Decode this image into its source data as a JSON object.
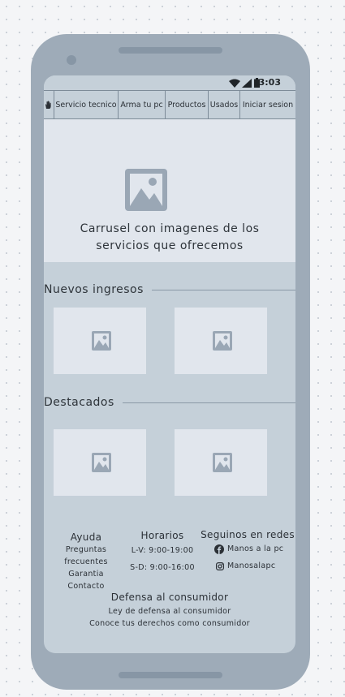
{
  "status_bar": {
    "time": "3:03"
  },
  "nav": {
    "items": [
      "Servicio tecnico",
      "Arma tu pc",
      "Productos",
      "Usados",
      "Iniciar sesion"
    ]
  },
  "hero": {
    "caption_line1": "Carrusel con imagenes de los",
    "caption_line2": "servicios que ofrecemos"
  },
  "sections": {
    "new": {
      "title": "Nuevos ingresos"
    },
    "featured": {
      "title": "Destacados"
    }
  },
  "footer": {
    "help": {
      "title": "Ayuda",
      "links": [
        "Preguntas frecuentes",
        "Garantia",
        "Contacto"
      ]
    },
    "hours": {
      "title": "Horarios",
      "lines": [
        "L-V: 9:00-19:00",
        "S-D: 9:00-16:00"
      ]
    },
    "social": {
      "title": "Seguinos en redes",
      "facebook": "Manos a la pc",
      "instagram": "Manosalapc"
    },
    "consumer": {
      "title": "Defensa al consumidor",
      "links": [
        "Ley de defensa al consumidor",
        "Conoce tus derechos como consumidor"
      ]
    }
  },
  "colors": {
    "screen_bg": "#c5d0d9",
    "placeholder_bg": "#e1e6ed",
    "device": "#9eabb8",
    "icon": "#9aa7b5"
  }
}
